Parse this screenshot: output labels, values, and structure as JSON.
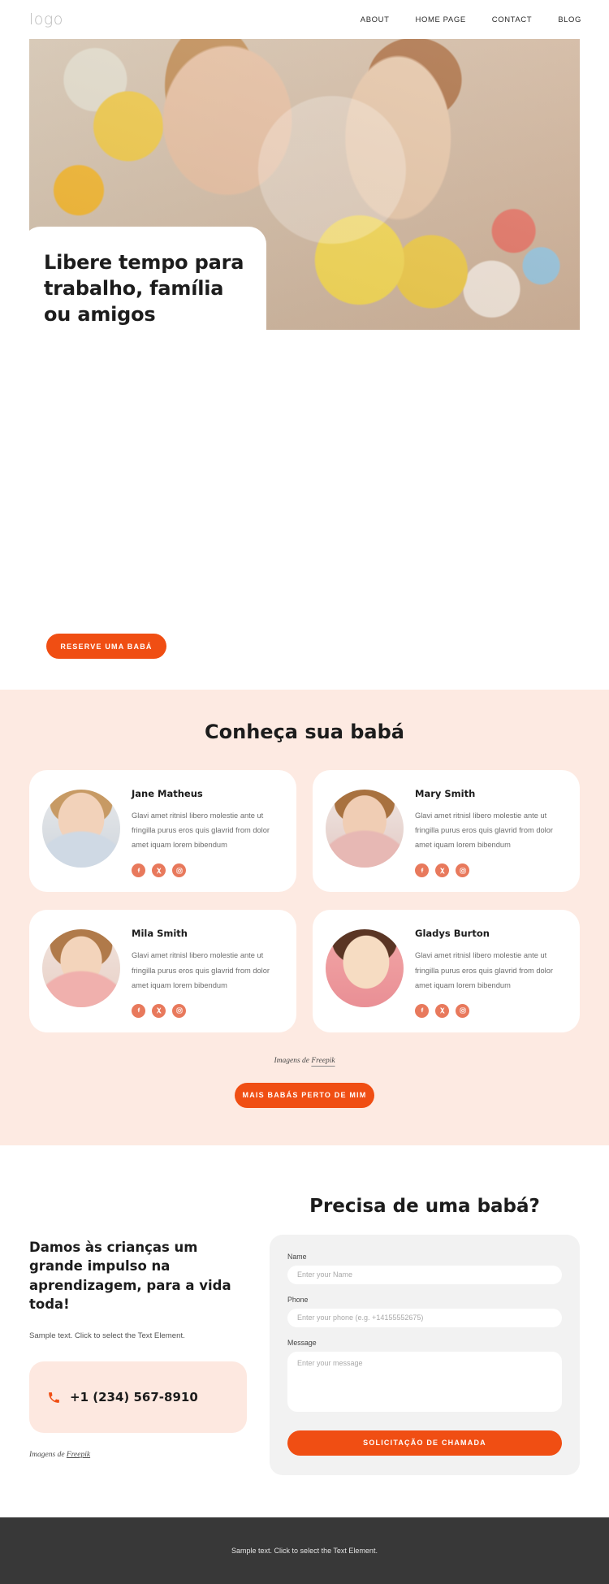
{
  "header": {
    "logo": "logo",
    "nav": [
      {
        "label": "ABOUT"
      },
      {
        "label": "HOME PAGE"
      },
      {
        "label": "CONTACT"
      },
      {
        "label": "BLOG"
      }
    ]
  },
  "hero": {
    "title": "Libere tempo para trabalho, família ou amigos",
    "cta": "RESERVE UMA BABÁ"
  },
  "team": {
    "heading": "Conheça sua babá",
    "body_text": "Glavi amet ritnisl libero molestie ante ut fringilla purus eros quis glavrid from dolor amet iquam lorem bibendum",
    "members": [
      {
        "name": "Jane Matheus"
      },
      {
        "name": "Mary Smith"
      },
      {
        "name": "Mila Smith"
      },
      {
        "name": "Gladys Burton"
      }
    ],
    "socials": [
      {
        "icon": "facebook-icon",
        "label": "Facebook"
      },
      {
        "icon": "x-twitter-icon",
        "label": "X"
      },
      {
        "icon": "instagram-icon",
        "label": "Instagram"
      }
    ],
    "credit": "Imagens de ",
    "credit_link": "Freepik",
    "cta": "MAIS BABÁS PERTO DE MIM"
  },
  "contact": {
    "left_heading": "Damos às crianças um grande impulso na aprendizagem, para a vida toda!",
    "left_text": "Sample text. Click to select the Text Element.",
    "phone": "+1 (234) 567-8910",
    "phone_icon": "phone-icon",
    "credit": "Imagens de ",
    "credit_link": "Freepik",
    "form_heading": "Precisa de uma babá?",
    "fields": [
      {
        "label": "Name",
        "placeholder": "Enter your Name",
        "value": ""
      },
      {
        "label": "Phone",
        "placeholder": "Enter your phone (e.g. +14155552675)",
        "value": ""
      },
      {
        "label": "Message",
        "placeholder": "Enter your message",
        "value": ""
      }
    ],
    "submit": "SOLICITAÇÃO DE CHAMADA"
  },
  "footer": {
    "text": "Sample text. Click to select the Text Element."
  },
  "colors": {
    "accent": "#f04e13",
    "section_bg": "#fdeae2",
    "social": "#e8795c",
    "footer_bg": "#383838"
  }
}
